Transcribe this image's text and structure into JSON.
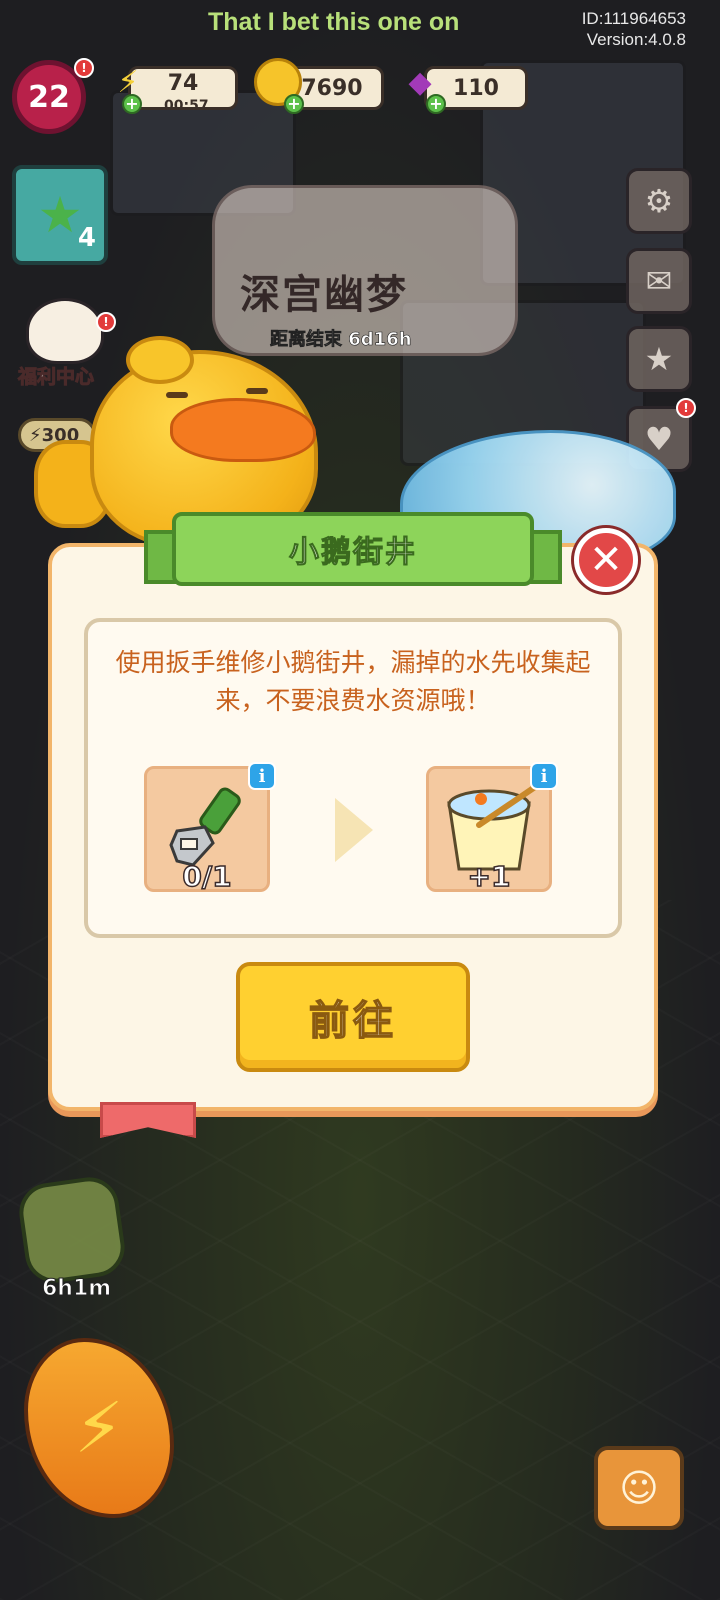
{
  "overlay": {
    "subtitle": "That I bet this one on",
    "player_id": "ID:111964653",
    "version": "Version:4.0.8"
  },
  "hud": {
    "level": "22",
    "energy": {
      "value": "74",
      "timer": "00:57",
      "icon": "lightning-icon"
    },
    "coins": {
      "value": "7690",
      "icon": "coin-icon"
    },
    "gems": {
      "value": "110",
      "icon": "gem-icon"
    }
  },
  "left_panel": {
    "task_count": "4",
    "welfare_label": "福利中心",
    "energy_pill": "300"
  },
  "event_banner": {
    "title": "深宫幽梦",
    "countdown": "距离结束 6d16h"
  },
  "dialog": {
    "title": "小鹅街井",
    "close_icon": "close-icon",
    "description": "使用扳手维修小鹅街井，漏掉的水先收集起来，不要浪费水资源哦！",
    "requirement": {
      "icon": "wrench-icon",
      "count": "0/1",
      "info": "i"
    },
    "reward": {
      "icon": "water-bucket-icon",
      "count": "+1",
      "info": "i"
    },
    "go_button": "前往"
  },
  "bottom": {
    "item_timer": "6h1m",
    "energy_button_icon": "lightning-icon",
    "chat_icon": "chat-icon"
  },
  "colors": {
    "accent_green": "#8dd45a",
    "dialog_bg": "#fdf6e6",
    "button_yellow": "#ffd030",
    "text_orange": "#c8621e",
    "close_red": "#e24848"
  }
}
